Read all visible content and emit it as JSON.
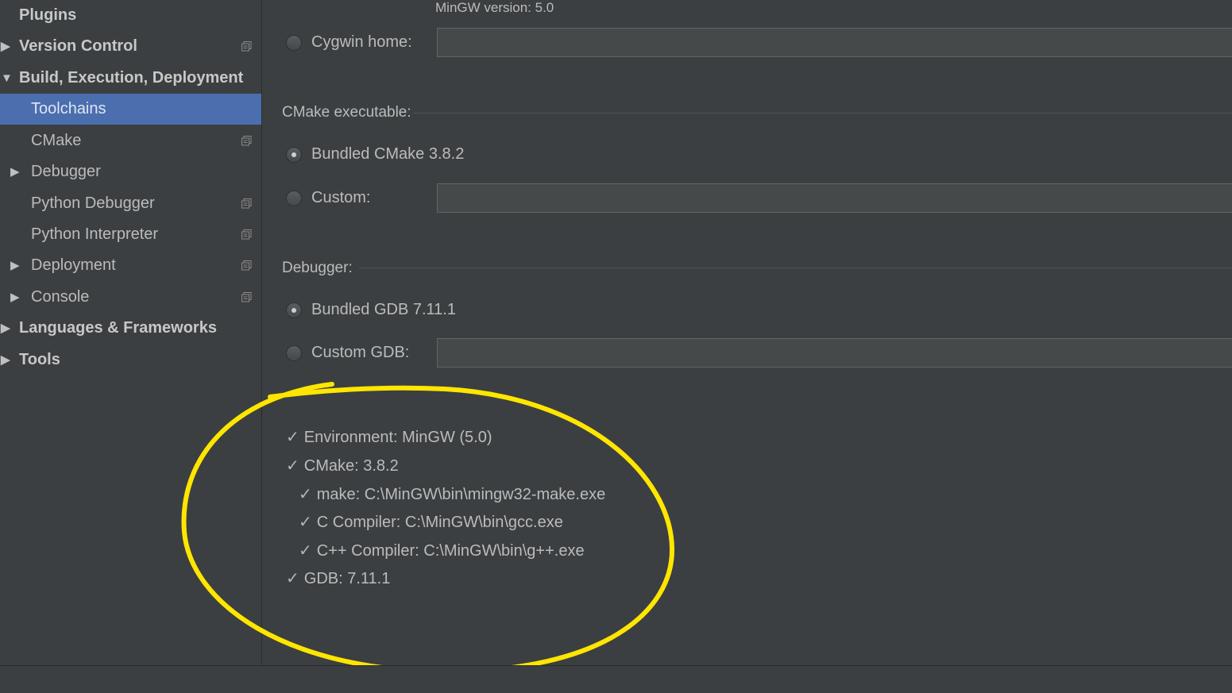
{
  "sidebar": {
    "items": [
      {
        "label": "Plugins"
      },
      {
        "label": "Version Control"
      },
      {
        "label": "Build, Execution, Deployment"
      },
      {
        "label": "Toolchains"
      },
      {
        "label": "CMake"
      },
      {
        "label": "Debugger"
      },
      {
        "label": "Python Debugger"
      },
      {
        "label": "Python Interpreter"
      },
      {
        "label": "Deployment"
      },
      {
        "label": "Console"
      },
      {
        "label": "Languages & Frameworks"
      },
      {
        "label": "Tools"
      }
    ]
  },
  "toolchain": {
    "mingw_version": "MinGW version: 5.0",
    "cygwin_home_label": "Cygwin home:",
    "cygwin_home_value": "",
    "cmake_section": "CMake executable:",
    "cmake_bundled": "Bundled CMake 3.8.2",
    "cmake_custom": "Custom:",
    "cmake_custom_value": "",
    "debugger_section": "Debugger:",
    "debugger_bundled": "Bundled GDB 7.11.1",
    "debugger_custom": "Custom GDB:",
    "debugger_custom_value": ""
  },
  "checks": [
    {
      "text": "Environment: MinGW (5.0)"
    },
    {
      "text": "CMake: 3.8.2"
    },
    {
      "text": "make: C:\\MinGW\\bin\\mingw32-make.exe"
    },
    {
      "text": "C Compiler: C:\\MinGW\\bin\\gcc.exe"
    },
    {
      "text": "C++ Compiler: C:\\MinGW\\bin\\g++.exe"
    },
    {
      "text": "GDB: 7.11.1"
    }
  ],
  "check_mark": "✓",
  "colors": {
    "background": "#3c3f41",
    "selection": "#4b6eaf",
    "annotation": "#ffe600"
  }
}
